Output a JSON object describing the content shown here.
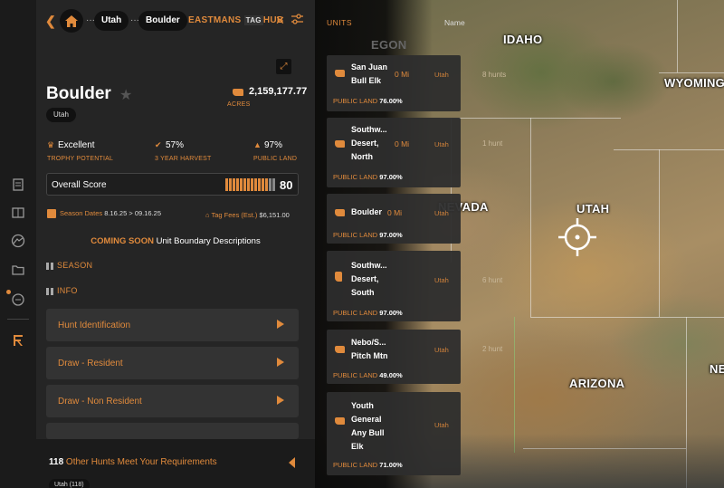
{
  "breadcrumb": {
    "state": "Utah",
    "unit": "Boulder"
  },
  "logo": {
    "main": "EASTMANS",
    "tag": "TAG",
    "suffix": "HUB"
  },
  "unit": {
    "name": "Boulder",
    "state": "Utah",
    "acres": "2,159,177.77",
    "acres_label": "ACRES"
  },
  "stats": [
    {
      "value": "Excellent",
      "label": "TROPHY POTENTIAL",
      "icon": "trophy-icon"
    },
    {
      "value": "57%",
      "label": "3 YEAR HARVEST",
      "icon": "check-circle-icon"
    },
    {
      "value": "97%",
      "label": "PUBLIC LAND",
      "icon": "trees-icon"
    }
  ],
  "overall": {
    "label": "Overall Score",
    "score": "80",
    "bars_on": 12,
    "bars_total": 14
  },
  "season": {
    "label": "Season Dates",
    "start": "8.16.25",
    "sep": ">",
    "end": "09.16.25"
  },
  "fees": {
    "label": "Tag Fees (Est.)",
    "value": "$6,151.00"
  },
  "coming_soon": {
    "label": "COMING SOON",
    "desc": "Unit Boundary Descriptions"
  },
  "sections": {
    "season": "SEASON",
    "info": "INFO"
  },
  "accordions": [
    "Hunt Identification",
    "Draw - Resident",
    "Draw - Non Resident"
  ],
  "footer": {
    "count": "118",
    "text": "Other Hunts Meet Your Requirements",
    "chip": "Utah (118)"
  },
  "units_list": {
    "header": "UNITS",
    "name_col": "Name",
    "items": [
      {
        "name": "San Juan Bull Elk",
        "dist": "0 Mi",
        "state": "Utah",
        "hunts": "8 hunts",
        "public_label": "PUBLIC LAND",
        "public": "76.00%"
      },
      {
        "name": "Southw... Desert, North",
        "dist": "0 Mi",
        "state": "Utah",
        "hunts": "1 hunt",
        "public_label": "PUBLIC LAND",
        "public": "97.00%"
      },
      {
        "name": "Boulder",
        "dist": "0 Mi",
        "state": "Utah",
        "hunts": "",
        "public_label": "PUBLIC LAND",
        "public": "97.00%"
      },
      {
        "name": "Southw... Desert, South",
        "dist": "0 Mi",
        "state": "Utah",
        "hunts": "6 hunt",
        "public_label": "PUBLIC LAND",
        "public": "97.00%"
      },
      {
        "name": "Nebo/S... Pitch Mtn",
        "dist": "0 Mi",
        "state": "Utah",
        "hunts": "2 hunt",
        "public_label": "PUBLIC LAND",
        "public": "49.00%"
      },
      {
        "name": "Youth General Any Bull Elk",
        "dist": "0 Mi",
        "state": "Utah",
        "hunts": "",
        "public_label": "PUBLIC LAND",
        "public": "71.00%"
      }
    ]
  },
  "map": {
    "labels": {
      "idaho": "IDAHO",
      "wyoming": "WYOMING",
      "nevada": "NEVADA",
      "utah": "UTAH",
      "arizona": "ARIZONA",
      "ne": "NE",
      "oregon_partial": "EGON"
    }
  },
  "colors": {
    "accent": "#e08a3c",
    "panel": "#252525",
    "rail": "#1b1b1b"
  }
}
